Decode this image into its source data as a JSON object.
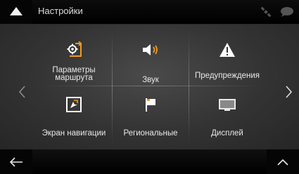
{
  "header": {
    "title": "Настройки"
  },
  "tiles": [
    {
      "label": "Параметры маршрута",
      "icon": "route-settings-icon"
    },
    {
      "label": "Звук",
      "icon": "speaker-icon"
    },
    {
      "label": "Предупреждения",
      "icon": "warning-icon"
    },
    {
      "label": "Экран навигации",
      "icon": "navigation-screen-icon"
    },
    {
      "label": "Региональные",
      "icon": "flag-icon"
    },
    {
      "label": "Дисплей",
      "icon": "display-icon"
    }
  ],
  "colors": {
    "accent": "#f39a1e",
    "background": "#333333",
    "bar": "#000000",
    "text": "#e8e8e8"
  }
}
